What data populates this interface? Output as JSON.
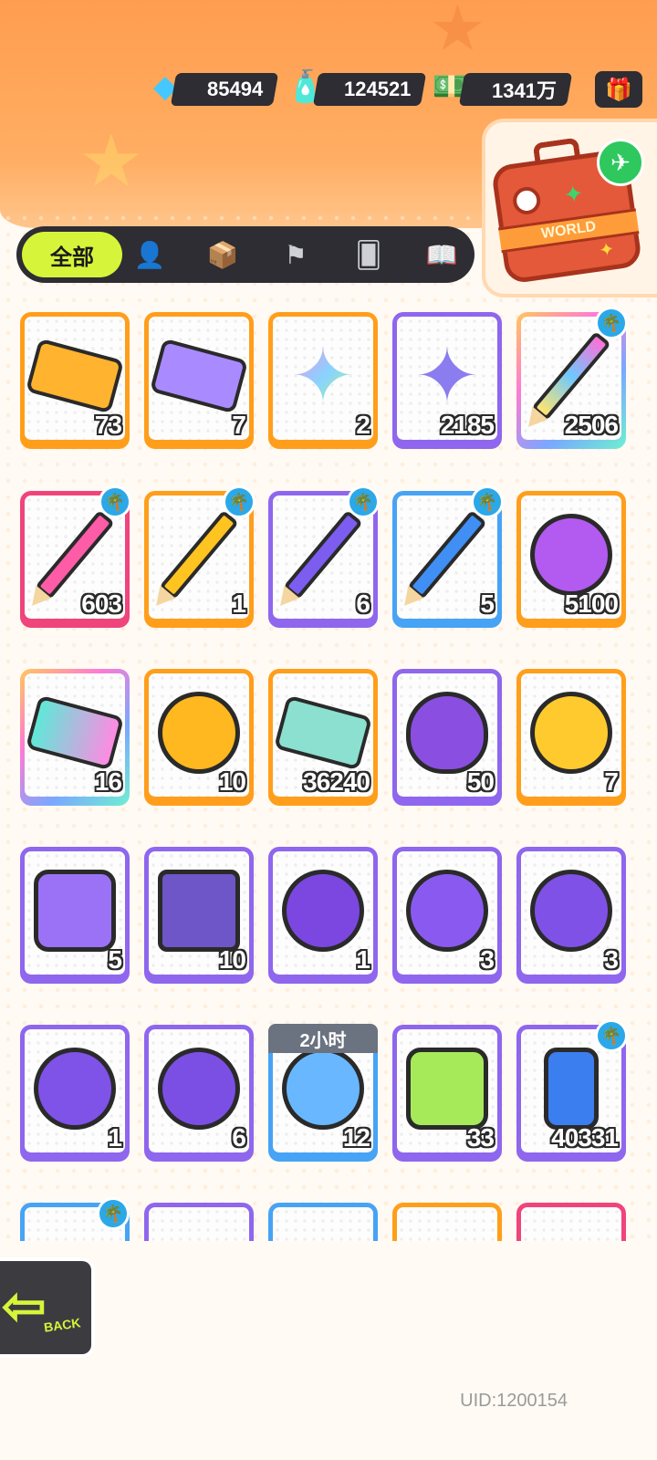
{
  "currencies": [
    {
      "name": "diamond",
      "icon": "diamond-icon",
      "value": "85494"
    },
    {
      "name": "spray",
      "icon": "spray-can-icon",
      "value": "124521"
    },
    {
      "name": "cash",
      "icon": "cash-icon",
      "value": "1341万"
    }
  ],
  "suitcase": {
    "label": "WORLD"
  },
  "tabs": {
    "active_label": "全部",
    "icons": [
      "person-icon",
      "box-icon",
      "flag-icon",
      "cards-icon",
      "book-icon"
    ]
  },
  "items": [
    {
      "name": "gold-ticket",
      "count": "73",
      "frame": "orange",
      "badge": false
    },
    {
      "name": "purple-ticket",
      "count": "7",
      "frame": "orange",
      "badge": false
    },
    {
      "name": "rainbow-star",
      "count": "2",
      "frame": "orange",
      "badge": false
    },
    {
      "name": "purple-star",
      "count": "2185",
      "frame": "purple",
      "badge": false
    },
    {
      "name": "rainbow-crayon",
      "count": "2506",
      "frame": "rainbow",
      "badge": true
    },
    {
      "name": "pink-crayon",
      "count": "603",
      "frame": "pink",
      "badge": true
    },
    {
      "name": "yellow-crayon",
      "count": "1",
      "frame": "orange",
      "badge": true
    },
    {
      "name": "purple-crayon",
      "count": "6",
      "frame": "purple",
      "badge": true
    },
    {
      "name": "blue-crayon",
      "count": "5",
      "frame": "blue",
      "badge": true
    },
    {
      "name": "cool-badge",
      "count": "5100",
      "frame": "orange",
      "badge": false
    },
    {
      "name": "lottery-ticket",
      "count": "16",
      "frame": "rainbow",
      "badge": false
    },
    {
      "name": "burst-coin",
      "count": "10",
      "frame": "orange",
      "badge": false
    },
    {
      "name": "season-ticket",
      "count": "36240",
      "frame": "orange",
      "badge": false
    },
    {
      "name": "mystery-egg",
      "count": "50",
      "frame": "purple",
      "badge": false
    },
    {
      "name": "deity-gold",
      "count": "7",
      "frame": "orange",
      "badge": false
    },
    {
      "name": "deity-purple",
      "count": "5",
      "frame": "purple",
      "badge": false
    },
    {
      "name": "travel-card",
      "count": "10",
      "frame": "purple",
      "badge": false
    },
    {
      "name": "mpet-bat",
      "count": "1",
      "frame": "purple",
      "badge": false
    },
    {
      "name": "mpet-fish",
      "count": "3",
      "frame": "purple",
      "badge": false
    },
    {
      "name": "mpet-apple",
      "count": "3",
      "frame": "purple",
      "badge": false
    },
    {
      "name": "mpet-sprout-yellow",
      "count": "1",
      "frame": "purple",
      "badge": false
    },
    {
      "name": "mpet-sprout-green",
      "count": "6",
      "frame": "purple",
      "badge": false
    },
    {
      "name": "alarm-clock",
      "count": "12",
      "frame": "blue",
      "badge": false
    },
    {
      "name": "green-cup",
      "count": "33",
      "frame": "purple",
      "badge": false
    },
    {
      "name": "spray-can",
      "count": "40331",
      "frame": "purple",
      "badge": true
    }
  ],
  "timer_label": "2小时",
  "back_button": {
    "label": "BACK"
  },
  "uid": "UID:1200154"
}
